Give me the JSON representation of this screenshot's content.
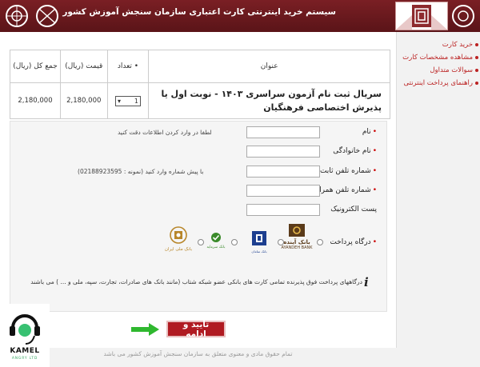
{
  "header": {
    "title": "سیستم خرید اینترنتی کارت اعتباری سازمان سنجش آموزش کشور"
  },
  "sidebar": {
    "items": [
      {
        "label": "خرید کارت"
      },
      {
        "label": "مشاهده مشخصات کارت"
      },
      {
        "label": "سوالات متداول"
      },
      {
        "label": "راهنمای پرداخت اینترنتی"
      }
    ]
  },
  "order": {
    "headers": {
      "title": "عنوان",
      "qty": "• تعداد",
      "price": "قیمت (ریال)",
      "total": "جمع کل (ریال)"
    },
    "item": {
      "title": "سریال ثبت نام آزمون سراسری ۱۴۰۳ - نوبت اول یا پذیرش اختصاصی فرهنگیان",
      "qty": "1",
      "price": "2,180,000",
      "total": "2,180,000"
    }
  },
  "form": {
    "name_label": "نام",
    "family_label": "نام خانوادگی",
    "phone_label": "شماره تلفن ثابت",
    "mobile_label": "شماره تلفن همراه",
    "email_label": "پست الکترونیک",
    "gateway_label": "درگاه پرداخت",
    "name_hint": "لطفا در وارد کردن اطلاعات دقت کنید",
    "phone_hint": "با پیش شماره وارد کنید (نمونه : 02188923595)",
    "required_mark": "•",
    "gateway_note": "درگاههای پرداخت فوق پذیرنده تمامی کارت های بانکی عضو شبکه شتاب (مانند بانک های صادرات، تجارت، سپه، ملی و ... ) می باشند"
  },
  "banks": [
    {
      "name": "بانک آینده",
      "sub": "AYANDEH BANK",
      "color": "#5b3b1a"
    },
    {
      "name": "بانک سامان",
      "sub": "",
      "color": "#1d3f8f"
    },
    {
      "name": "بانک سرمایه",
      "sub": "",
      "color": "#3a8a2a"
    },
    {
      "name": "بانک ملی",
      "sub": "بانک ملی ایران",
      "color": "#b8862a"
    }
  ],
  "submit_label": "تایید و ادامه",
  "watermark": {
    "name": "KAMEL",
    "sub": "ANGRY LTD"
  },
  "footer": "تمام حقوق مادی و معنوی متعلق به سازمان سنجش آموزش کشور می باشد",
  "colors": {
    "brand": "#7a1f24",
    "accent": "#b01b22",
    "link": "#bb2222"
  }
}
